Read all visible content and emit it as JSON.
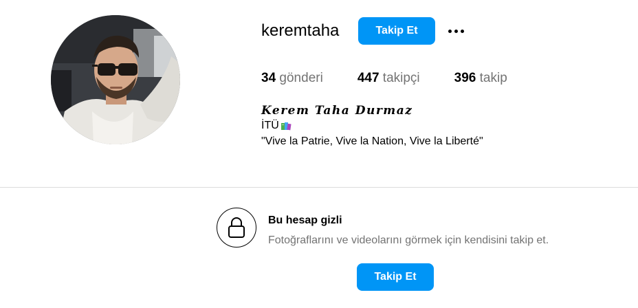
{
  "profile": {
    "username": "keremtaha",
    "follow_label": "Takip Et",
    "more_icon": "more-options-icon",
    "avatar_icon": "profile-photo"
  },
  "stats": {
    "posts": {
      "count": "34",
      "label": "gönderi"
    },
    "followers": {
      "count": "447",
      "label": "takipçi"
    },
    "following": {
      "count": "396",
      "label": "takip"
    }
  },
  "bio": {
    "full_name": "Kerem Taha Durmaz",
    "school": "İTÜ",
    "school_emoji_icon": "books-icon",
    "quote": "\"Vive la Patrie, Vive la Nation, Vive la Liberté\""
  },
  "private_notice": {
    "icon": "lock-icon",
    "title": "Bu hesap gizli",
    "description": "Fotoğraflarını ve videolarını görmek için kendisini takip et.",
    "follow_label": "Takip Et"
  },
  "colors": {
    "accent": "#0095f6",
    "secondary_text": "#737373",
    "divider": "#dbdbdb"
  }
}
